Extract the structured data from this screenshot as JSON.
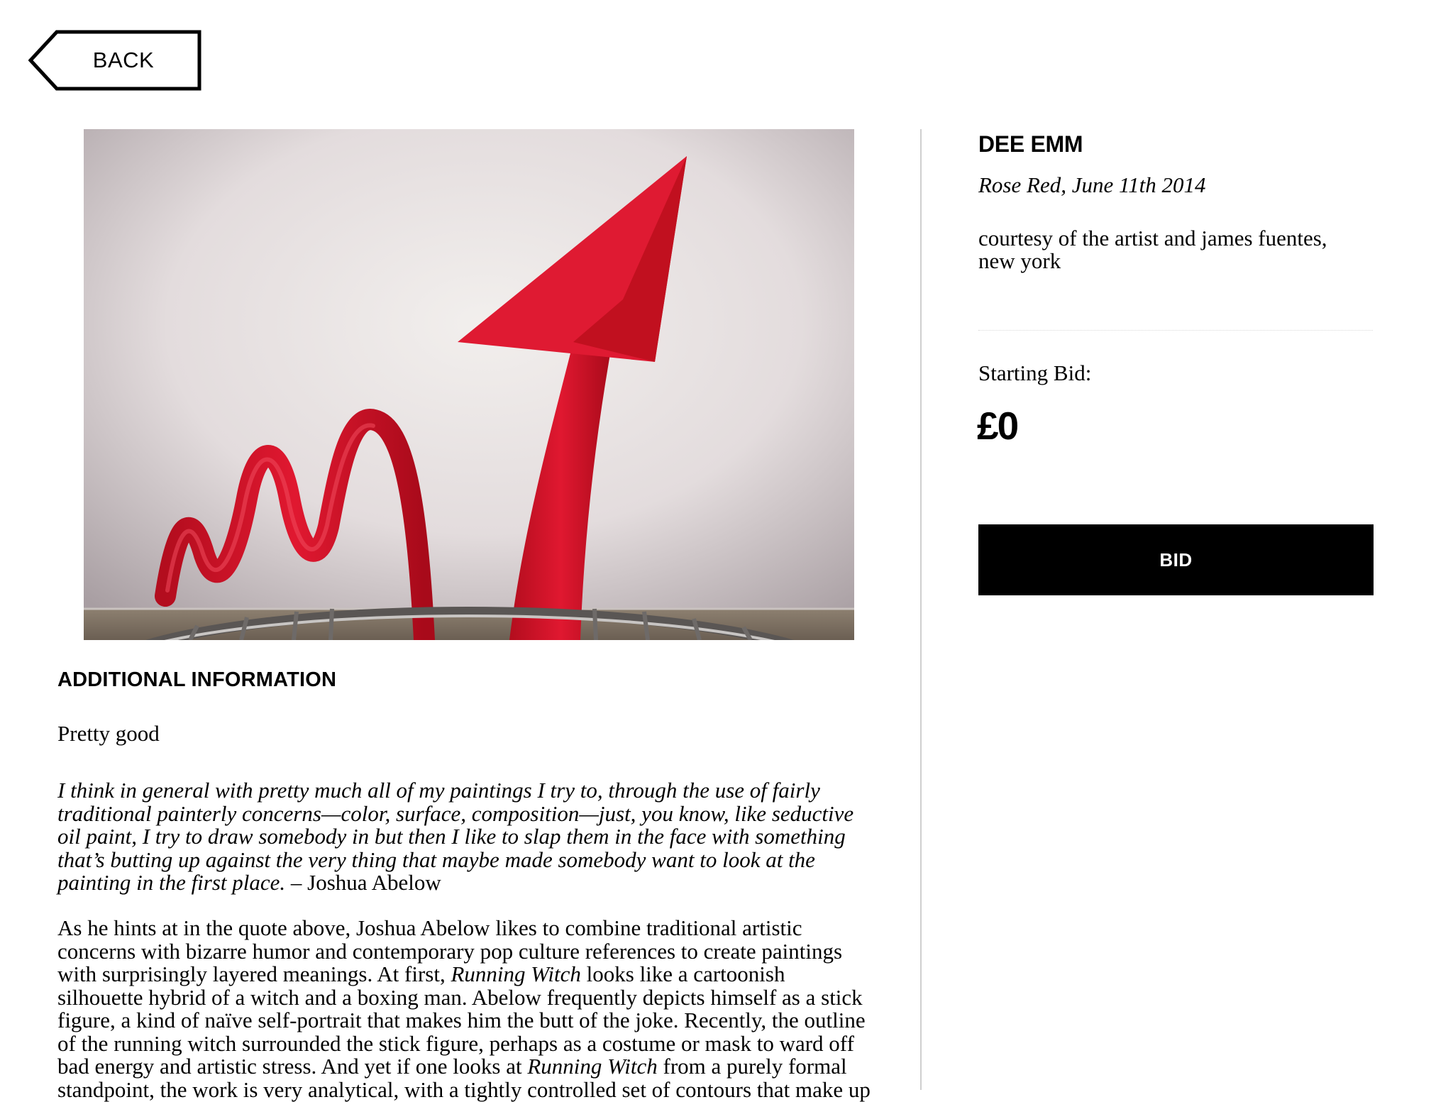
{
  "nav": {
    "back_label": "BACK"
  },
  "artwork": {
    "image_icon": "red-arrow-sculpture-photo",
    "artist": "DEE EMM",
    "title": "Rose Red, June 11th 2014",
    "courtesy": "courtesy of the artist and james fuentes, new york"
  },
  "bidding": {
    "starting_label": "Starting Bid:",
    "amount": "£0",
    "button_label": "BID"
  },
  "info": {
    "heading": "ADDITIONAL INFORMATION",
    "intro": "Pretty good",
    "quote": "I think in general with pretty much all of my paintings I try to, through the use of fairly traditional painterly concerns—color, surface, composition—just, you know, like seductive oil paint, I try to draw somebody in but then I like to slap them in the face with something that’s butting up against the very thing that maybe made somebody want to look at the painting in the first place.",
    "quote_attribution": " – Joshua Abelow",
    "desc_1": "As he hints at in the quote above, Joshua Abelow likes to combine traditional artistic concerns with bizarre humor and contemporary pop culture references to create paintings with surprisingly layered meanings. At first, ",
    "desc_work_1": "Running Witch",
    "desc_2": " looks like a cartoonish silhouette hybrid of a witch and a boxing man. Abelow frequently depicts himself as a stick figure, a kind of naïve self-portrait that makes him the butt of the joke. Recently, the outline of the running witch surrounded the stick figure, perhaps as a costume or mask to ward off bad energy and artistic stress. And yet if one looks at ",
    "desc_work_2": "Running Witch",
    "desc_3": " from a purely formal standpoint, the work is very analytical, with a tightly controlled set of contours that make up"
  },
  "colors": {
    "accent_red": "#d8142a",
    "button_bg": "#000000",
    "divider": "#cfcfcf"
  }
}
